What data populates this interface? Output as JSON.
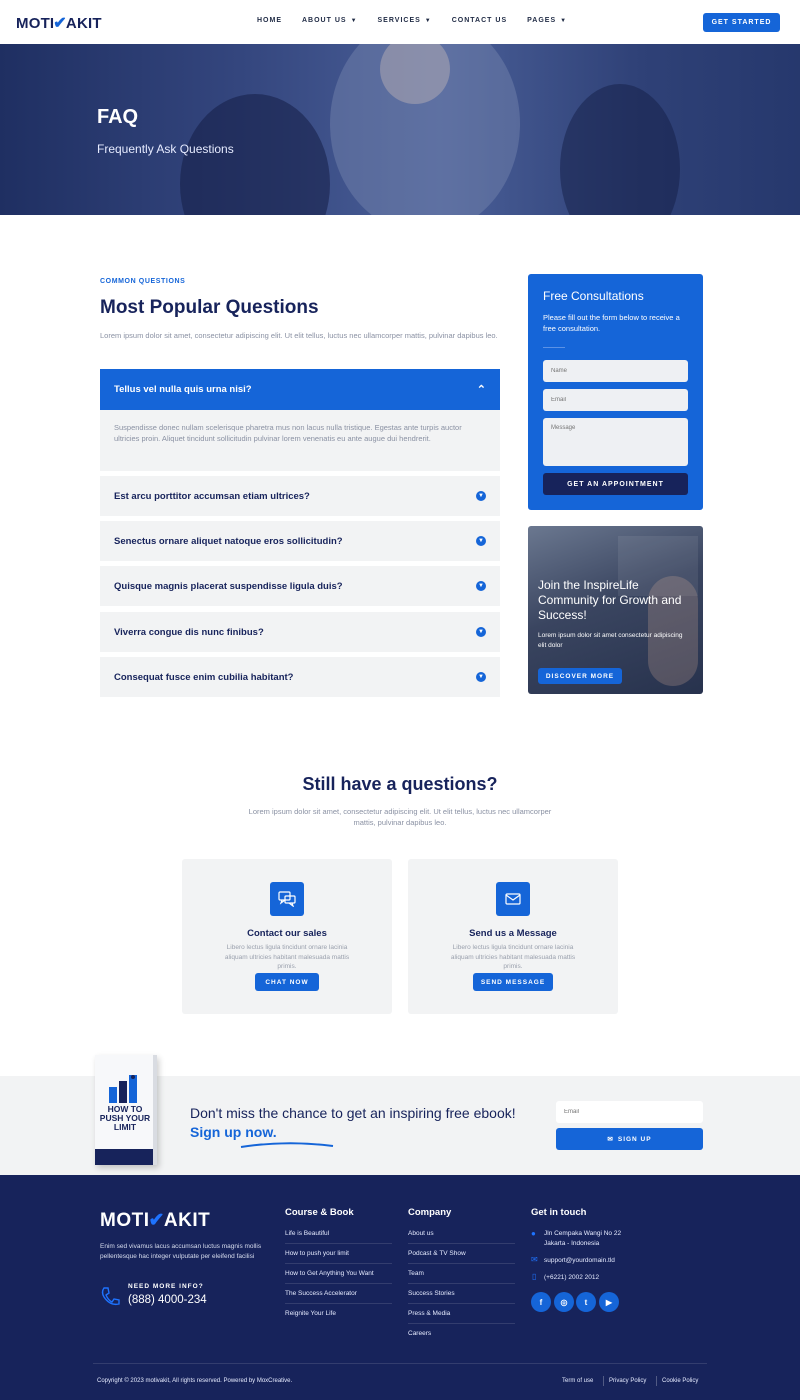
{
  "brand": {
    "logo_left": "MOTI",
    "logo_right": "AKIT"
  },
  "nav": {
    "items": [
      {
        "label": "HOME",
        "dropdown": false
      },
      {
        "label": "ABOUT US",
        "dropdown": true
      },
      {
        "label": "SERVICES",
        "dropdown": true
      },
      {
        "label": "CONTACT US",
        "dropdown": false
      },
      {
        "label": "PAGES",
        "dropdown": true
      }
    ],
    "cta": "GET STARTED"
  },
  "hero": {
    "title": "FAQ",
    "subtitle": "Frequently Ask Questions"
  },
  "faq": {
    "eyebrow": "COMMON QUESTIONS",
    "title": "Most Popular Questions",
    "description": "Lorem ipsum dolor sit amet, consectetur adipiscing elit. Ut elit tellus, luctus nec ullamcorper mattis, pulvinar dapibus leo.",
    "open_item": {
      "question": "Tellus vel nulla quis urna nisi?",
      "answer": "Suspendisse donec nullam scelerisque pharetra mus non lacus nulla tristique. Egestas ante turpis auctor ultricies proin. Aliquet tincidunt sollicitudin pulvinar lorem venenatis eu ante augue dui hendrerit."
    },
    "items": [
      "Est arcu porttitor accumsan etiam ultrices?",
      "Senectus ornare aliquet natoque eros sollicitudin?",
      "Quisque magnis placerat suspendisse ligula duis?",
      "Viverra congue dis nunc finibus?",
      "Consequat fusce enim cubilia habitant?"
    ]
  },
  "consultation": {
    "title": "Free Consultations",
    "description": "Please fill out the form below to receive a free consultation.",
    "name_placeholder": "Name",
    "email_placeholder": "Email",
    "message_placeholder": "Message",
    "button": "GET AN APPOINTMENT"
  },
  "community": {
    "title": "Join the InspireLife Community for Growth and Success!",
    "description": "Lorem ipsum dolor sit amet consectetur adipiscing elit dolor",
    "button": "DISCOVER MORE"
  },
  "still": {
    "title": "Still have a questions?",
    "description": "Lorem ipsum dolor sit amet, consectetur adipiscing elit. Ut elit tellus, luctus nec ullamcorper mattis, pulvinar dapibus leo.",
    "cards": [
      {
        "icon": "chat-icon",
        "title": "Contact our sales",
        "description": "Libero lectus ligula tincidunt ornare lacinia aliquam ultricies habitant malesuada mattis primis.",
        "button": "CHAT NOW"
      },
      {
        "icon": "mail-icon",
        "title": "Send us a Message",
        "description": "Libero lectus ligula tincidunt ornare lacinia aliquam ultricies habitant malesuada mattis primis.",
        "button": "SEND MESSAGE"
      }
    ]
  },
  "newsletter": {
    "book_title": "HOW TO PUSH YOUR LIMIT",
    "text": "Don't miss the chance to get an inspiring free ebook!",
    "highlight": "Sign up now.",
    "email_placeholder": "Email",
    "button": "SIGN UP"
  },
  "footer": {
    "description": "Enim sed vivamus lacus accumsan luctus magnis mollis pellentesque hac integer vulputate per eleifend facilisi",
    "need_info": "NEED MORE INFO?",
    "phone": "(888) 4000-234",
    "course_title": "Course & Book",
    "course_links": [
      "Life is Beautiful",
      "How to push your limit",
      "How to Get Anything You Want",
      "The Success Accelerator",
      "Reignite Your Life"
    ],
    "company_title": "Company",
    "company_links": [
      "About us",
      "Podcast & TV Show",
      "Team",
      "Success Stories",
      "Press & Media",
      "Careers"
    ],
    "touch_title": "Get in touch",
    "address_line1": "Jln Cempaka Wangi No 22",
    "address_line2": "Jakarta - Indonesia",
    "email": "support@yourdomain.tld",
    "tel": "(+6221) 2002 2012",
    "social": [
      "facebook-icon",
      "instagram-icon",
      "twitter-icon",
      "youtube-icon"
    ],
    "copyright": "Copyright © 2023 motivakit, All rights reserved. Powered by MoxCreative.",
    "legal": [
      "Term of use",
      "Privacy Policy",
      "Cookie Policy"
    ]
  },
  "colors": {
    "primary": "#1565d8",
    "navy": "#17235b",
    "light_bg": "#f2f3f4"
  }
}
